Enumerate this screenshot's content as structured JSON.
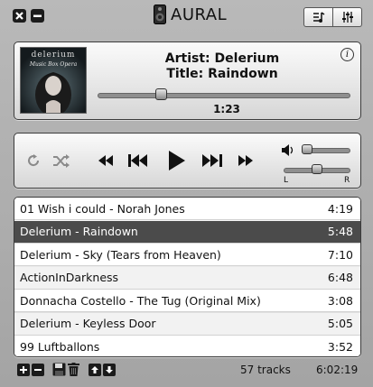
{
  "app": {
    "title": "AURAL"
  },
  "now_playing": {
    "artist_label": "Artist:",
    "artist": "Delerium",
    "title_label": "Title:",
    "title": "Raindown",
    "elapsed": "1:23",
    "progress_fraction": 0.25,
    "album_art_text": "delerium",
    "album_art_script": "Music Box Opera"
  },
  "volume": {
    "level_fraction": 0.1,
    "balance_fraction": 0.5,
    "left_label": "L",
    "right_label": "R"
  },
  "tracks": [
    {
      "name": "01 Wish i could - Norah Jones",
      "duration": "4:19",
      "selected": false
    },
    {
      "name": "Delerium - Raindown",
      "duration": "5:48",
      "selected": true
    },
    {
      "name": "Delerium - Sky (Tears from Heaven)",
      "duration": "7:10",
      "selected": false
    },
    {
      "name": "ActionInDarkness",
      "duration": "6:48",
      "selected": false
    },
    {
      "name": "Donnacha Costello - The Tug (Original Mix)",
      "duration": "3:08",
      "selected": false
    },
    {
      "name": "Delerium - Keyless Door",
      "duration": "5:05",
      "selected": false
    },
    {
      "name": "99 Luftballons",
      "duration": "3:52",
      "selected": false
    }
  ],
  "footer": {
    "track_count": "57 tracks",
    "total_time": "6:02:19"
  },
  "colors": {
    "selected_row": "#4b4b4b",
    "panel_border": "#3c3c3c",
    "background": "#adadad"
  }
}
